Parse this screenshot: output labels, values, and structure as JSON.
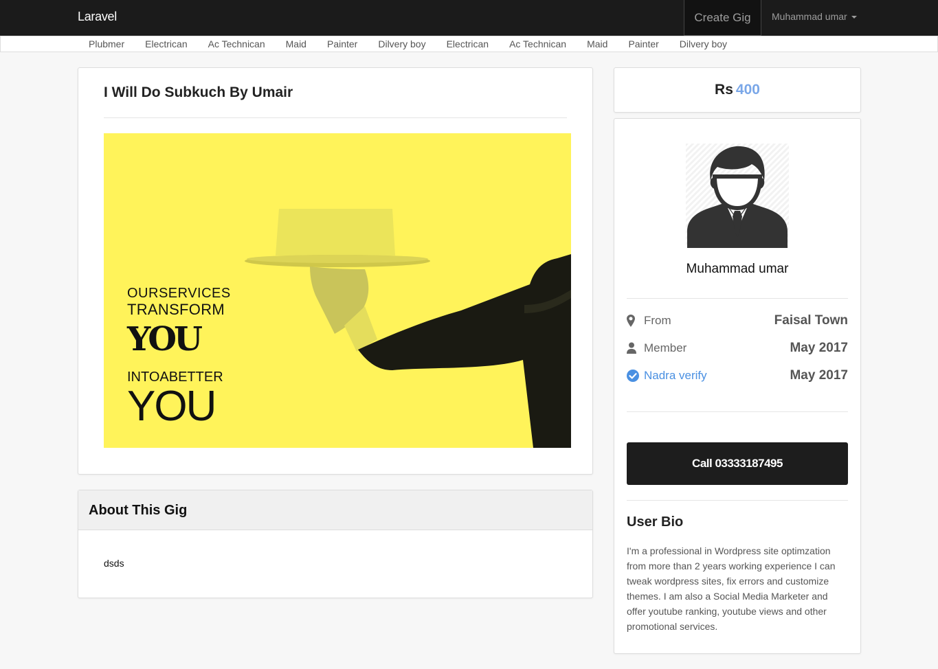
{
  "navbar": {
    "brand": "Laravel",
    "create_gig": "Create Gig",
    "user_name": "Muhammad umar"
  },
  "categories": [
    "Plubmer",
    "Electrican",
    "Ac Technican",
    "Maid",
    "Painter",
    "Dilvery boy",
    "Electrican",
    "Ac Technican",
    "Maid",
    "Painter",
    "Dilvery boy"
  ],
  "gig": {
    "title": "I Will Do Subkuch By Umair",
    "image_text": {
      "line1": "OURSERVICES",
      "line2": "TRANSFORM",
      "line3": "YOU",
      "line4": "INTOABETTER",
      "line5": "YOU"
    }
  },
  "about": {
    "title": "About This Gig",
    "body": "dsds"
  },
  "price": {
    "currency": "Rs",
    "amount": "400"
  },
  "profile": {
    "name": "Muhammad umar",
    "rows": [
      {
        "label": "From",
        "value": "Faisal Town",
        "icon": "map-marker-icon"
      },
      {
        "label": "Member",
        "value": "May 2017",
        "icon": "user-icon"
      },
      {
        "label": "Nadra verify",
        "value": "May 2017",
        "icon": "check-circle-icon"
      }
    ],
    "call_label": "Call 03333187495",
    "bio_title": "User Bio",
    "bio_text": "I'm a professional in Wordpress site optimzation from more than 2 years working experience I can tweak wordpress sites, fix errors and customize themes. I am also a Social Media Marketer and offer youtube ranking, youtube views and other promotional services."
  },
  "colors": {
    "navbar": "#1b1b1b",
    "accent_link": "#4a90e2",
    "price_amount": "#7aa7e8",
    "image_bg": "#fff35a",
    "button": "#1d1d1d"
  }
}
